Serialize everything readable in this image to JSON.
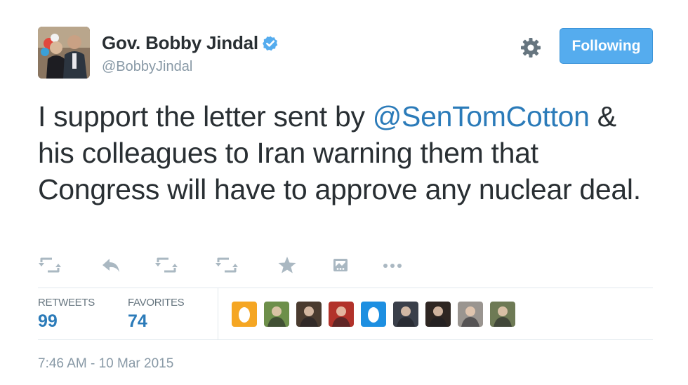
{
  "author": {
    "display_name": "Gov. Bobby Jindal",
    "handle": "@BobbyJindal",
    "verified": true,
    "verified_icon": "verified-badge-icon",
    "avatar_icon": "profile-photo"
  },
  "header": {
    "settings_icon": "gear-icon",
    "follow_button_label": "Following"
  },
  "tweet": {
    "text_before": "I support the letter sent by ",
    "mention": "@SenTomCotton",
    "text_after": " & his colleagues to Iran warning them that Congress will have to approve any nuclear deal."
  },
  "actions": [
    {
      "name": "retweet-icon"
    },
    {
      "name": "reply-icon"
    },
    {
      "name": "retweet-icon"
    },
    {
      "name": "retweet-icon"
    },
    {
      "name": "favorite-star-icon"
    },
    {
      "name": "media-icon"
    },
    {
      "name": "more-dots-icon"
    }
  ],
  "stats": {
    "retweets_label": "RETWEETS",
    "retweets_count": "99",
    "favorites_label": "FAVORITES",
    "favorites_count": "74"
  },
  "engagers": [
    {
      "kind": "default-egg",
      "color": "#f5a623"
    },
    {
      "kind": "photo",
      "color": "#6d8f4a"
    },
    {
      "kind": "photo",
      "color": "#4a3b2f"
    },
    {
      "kind": "photo",
      "color": "#b2322a"
    },
    {
      "kind": "default-egg",
      "color": "#1d8fe1"
    },
    {
      "kind": "photo",
      "color": "#3a3f4a"
    },
    {
      "kind": "photo",
      "color": "#2e2622"
    },
    {
      "kind": "photo",
      "color": "#9a9590"
    },
    {
      "kind": "photo",
      "color": "#6e7a55"
    }
  ],
  "colors": {
    "accent": "#55acee",
    "link": "#2b7bb9",
    "muted": "#8899a6",
    "text": "#292f33",
    "border": "#e1e8ed"
  },
  "timestamp": "7:46 AM - 10 Mar 2015"
}
